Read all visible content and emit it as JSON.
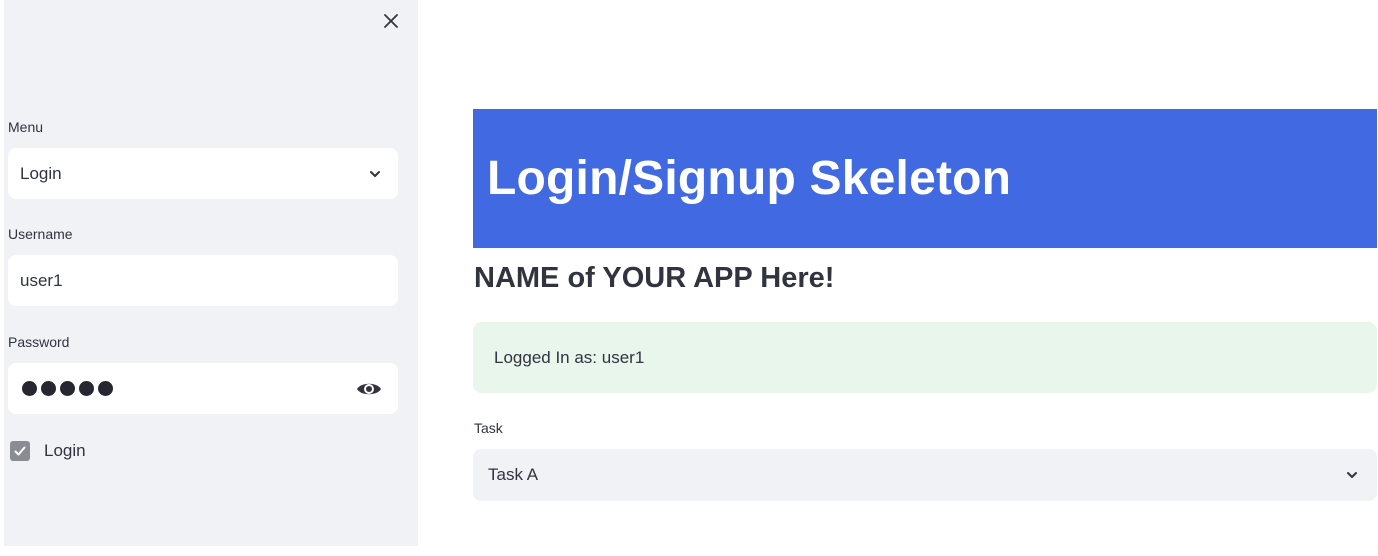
{
  "sidebar": {
    "close_icon": "close-icon",
    "menu": {
      "label": "Menu",
      "value": "Login"
    },
    "username": {
      "label": "Username",
      "value": "user1"
    },
    "password": {
      "label": "Password",
      "masked_length": 5,
      "toggle_icon": "eye-icon"
    },
    "login_checkbox": {
      "label": "Login",
      "checked": true
    }
  },
  "main": {
    "banner_title": "Login/Signup Skeleton",
    "subtitle": "NAME of YOUR APP Here!",
    "alert": {
      "text": "Logged In as: user1",
      "bg_color": "#e8f6ec"
    },
    "task": {
      "label": "Task",
      "value": "Task A"
    }
  },
  "colors": {
    "banner": "#4169e1",
    "sidebar_bg": "#f0f2f6",
    "text": "#31333f"
  }
}
